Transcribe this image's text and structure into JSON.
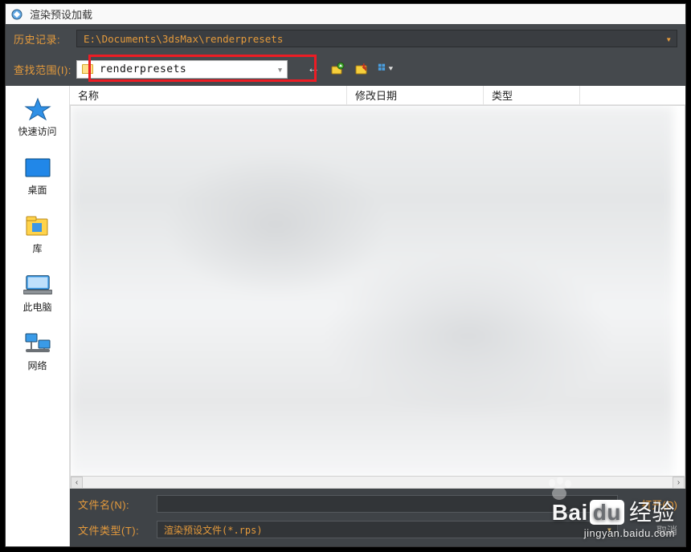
{
  "window": {
    "title": "渲染预设加载"
  },
  "history": {
    "label": "历史记录:",
    "path": "E:\\Documents\\3dsMax\\renderpresets"
  },
  "lookin": {
    "label": "查找范围(I):",
    "folder": "renderpresets"
  },
  "columns": {
    "name": "名称",
    "date": "修改日期",
    "type": "类型"
  },
  "sidebar": {
    "items": [
      {
        "label": "快速访问"
      },
      {
        "label": "桌面"
      },
      {
        "label": "库"
      },
      {
        "label": "此电脑"
      },
      {
        "label": "网络"
      }
    ]
  },
  "bottom": {
    "filename_label": "文件名(N):",
    "filetype_label": "文件类型(T):",
    "filetype_value": "渲染预设文件(*.rps)",
    "open_label": "打开(O)",
    "cancel_label": "取消"
  },
  "watermark": {
    "brand_left": "Bai",
    "brand_box": "du",
    "brand_right": "经验",
    "url": "jingyan.baidu.com"
  }
}
